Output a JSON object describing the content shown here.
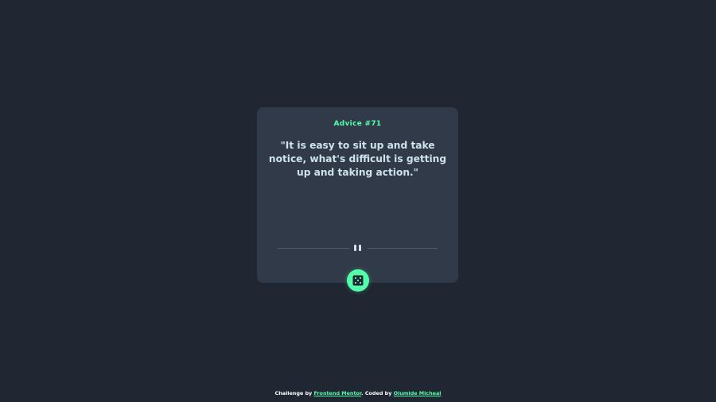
{
  "card": {
    "advice_id": "Advice #71",
    "quote": "\"It is easy to sit up and take notice, what's difficult is getting up and taking action.\""
  },
  "icons": {
    "divider": "pause-icon",
    "button": "dice-icon"
  },
  "footer": {
    "challenge_prefix": "Challenge by",
    "challenge_link": "Frontend Mentor",
    "coded_prefix": ". Coded by",
    "coded_link": "Olumide Micheal"
  },
  "colors": {
    "background": "#202632",
    "card": "#313a48",
    "accent": "#53ffaa",
    "text": "#cee3e9",
    "divider": "#4f5d74"
  }
}
